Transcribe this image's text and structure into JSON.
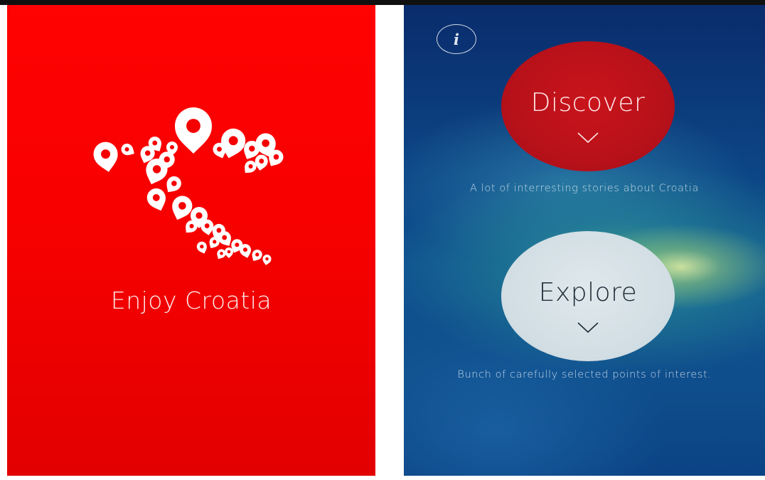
{
  "splash": {
    "title": "Enjoy Croatia",
    "background_color": "#f50000",
    "logo_icon": "croatia-map-pins-logo"
  },
  "home": {
    "info_button": {
      "icon": "info-icon",
      "glyph": "i"
    },
    "discover": {
      "label": "Discover",
      "icon": "chevron-down-icon",
      "caption": "A lot of interresting stories about Croatia",
      "color": "#b8111a"
    },
    "explore": {
      "label": "Explore",
      "icon": "chevron-down-icon",
      "caption": "Bunch of carefully selected points of interest.",
      "color": "#d6e1e7"
    }
  }
}
